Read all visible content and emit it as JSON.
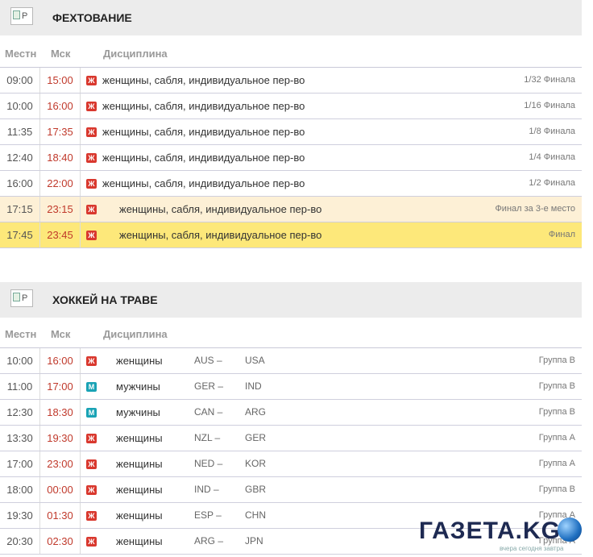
{
  "columns": {
    "local": "Местн",
    "msk": "Мск",
    "discipline": "Дисциплина"
  },
  "fencing": {
    "logo_alt": "P",
    "title": "ФЕХТОВАНИЕ",
    "rows": [
      {
        "local": "09:00",
        "msk": "15:00",
        "badge": "Ж",
        "discipline": "женщины, сабля, индивидуальное пер-во",
        "stage": "1/32 Финала"
      },
      {
        "local": "10:00",
        "msk": "16:00",
        "badge": "Ж",
        "discipline": "женщины, сабля, индивидуальное пер-во",
        "stage": "1/16 Финала"
      },
      {
        "local": "11:35",
        "msk": "17:35",
        "badge": "Ж",
        "discipline": "женщины, сабля, индивидуальное пер-во",
        "stage": "1/8 Финала"
      },
      {
        "local": "12:40",
        "msk": "18:40",
        "badge": "Ж",
        "discipline": "женщины, сабля, индивидуальное пер-во",
        "stage": "1/4 Финала"
      },
      {
        "local": "16:00",
        "msk": "22:00",
        "badge": "Ж",
        "discipline": "женщины, сабля, индивидуальное пер-во",
        "stage": "1/2 Финала"
      },
      {
        "local": "17:15",
        "msk": "23:15",
        "badge": "Ж",
        "discipline": "женщины, сабля, индивидуальное пер-во",
        "stage": "Финал за 3-е место"
      },
      {
        "local": "17:45",
        "msk": "23:45",
        "badge": "Ж",
        "discipline": "женщины, сабля, индивидуальное пер-во",
        "stage": "Финал"
      }
    ]
  },
  "hockey": {
    "logo_alt": "P",
    "title": "ХОККЕЙ НА ТРАВЕ",
    "rows": [
      {
        "local": "10:00",
        "msk": "16:00",
        "badge": "Ж",
        "discipline": "женщины",
        "team1": "AUS –",
        "team2": "USA",
        "stage": "Группа B"
      },
      {
        "local": "11:00",
        "msk": "17:00",
        "badge": "М",
        "discipline": "мужчины",
        "team1": "GER –",
        "team2": "IND",
        "stage": "Группа B"
      },
      {
        "local": "12:30",
        "msk": "18:30",
        "badge": "М",
        "discipline": "мужчины",
        "team1": "CAN –",
        "team2": "ARG",
        "stage": "Группа B"
      },
      {
        "local": "13:30",
        "msk": "19:30",
        "badge": "Ж",
        "discipline": "женщины",
        "team1": "NZL –",
        "team2": "GER",
        "stage": "Группа A"
      },
      {
        "local": "17:00",
        "msk": "23:00",
        "badge": "Ж",
        "discipline": "женщины",
        "team1": "NED –",
        "team2": "KOR",
        "stage": "Группа A"
      },
      {
        "local": "18:00",
        "msk": "00:00",
        "badge": "Ж",
        "discipline": "женщины",
        "team1": "IND –",
        "team2": "GBR",
        "stage": "Группа B"
      },
      {
        "local": "19:30",
        "msk": "01:30",
        "badge": "Ж",
        "discipline": "женщины",
        "team1": "ESP –",
        "team2": "CHN",
        "stage": "Группа A"
      },
      {
        "local": "20:30",
        "msk": "02:30",
        "badge": "Ж",
        "discipline": "женщины",
        "team1": "ARG –",
        "team2": "JPN",
        "stage": "Группа A"
      }
    ]
  },
  "watermark": {
    "text": "ГАЗЕТА.KG",
    "subtitle": "вчера сегодня завтра"
  },
  "colors": {
    "women_badge": "#d9382e",
    "men_badge": "#1aa3b5",
    "bronze_row": "#fdf0d6",
    "gold_row": "#fde87a",
    "msk_time": "#c0392b"
  },
  "icons": {
    "sport_logo": "broken-image-icon",
    "globe": "globe-icon"
  }
}
